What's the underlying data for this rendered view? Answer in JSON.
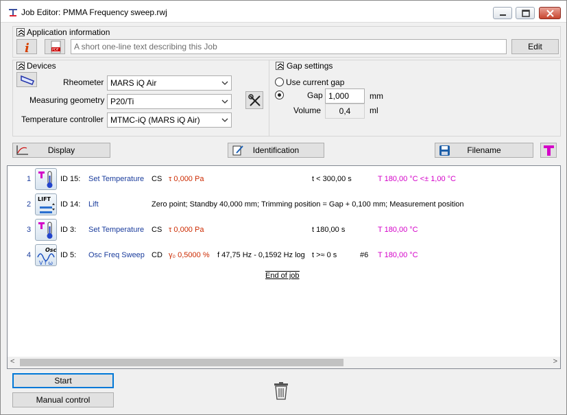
{
  "window": {
    "title": "Job Editor: PMMA Frequency sweep.rwj"
  },
  "application_info": {
    "header": "Application information",
    "description_placeholder": "A short one-line text describing this Job",
    "edit_label": "Edit"
  },
  "devices": {
    "header": "Devices",
    "rheometer_label": "Rheometer",
    "rheometer_value": "MARS iQ Air",
    "geometry_label": "Measuring geometry",
    "geometry_value": "P20/Ti",
    "temp_label": "Temperature controller",
    "temp_value": "MTMC-iQ (MARS iQ Air)"
  },
  "gap": {
    "header": "Gap settings",
    "use_current_label": "Use current gap",
    "gap_label": "Gap",
    "gap_value": "1,000",
    "gap_unit": "mm",
    "volume_label": "Volume",
    "volume_value": "0,4",
    "volume_unit": "ml",
    "selected": "gap"
  },
  "toolbar": {
    "display_label": "Display",
    "identification_label": "Identification",
    "filename_label": "Filename"
  },
  "job_steps": [
    {
      "num": "1",
      "id": "ID 15:",
      "name": "Set Temperature",
      "mode": "CS",
      "param": "τ 0,000 Pa",
      "time": "t < 300,00 s",
      "temp": "T 180,00 °C <± 1,00 °C",
      "icon": "thermometer-icon"
    },
    {
      "num": "2",
      "id": "ID 14:",
      "name": "Lift",
      "detail": "Zero point; Standby 40,000 mm; Trimming position = Gap  + 0,100 mm; Measurement position",
      "icon": "lift-icon"
    },
    {
      "num": "3",
      "id": "ID 3:",
      "name": "Set Temperature",
      "mode": "CS",
      "param": "τ 0,000 Pa",
      "time": "t 180,00 s",
      "temp": "T 180,00 °C",
      "icon": "thermometer-icon"
    },
    {
      "num": "4",
      "id": "ID 5:",
      "name": "Osc Freq Sweep",
      "mode": "CD",
      "param": "γ₀ 0,5000 %",
      "freq": "f 47,75 Hz - 0,1592 Hz log",
      "time": "t >≈ 0 s",
      "count": "#6",
      "temp": "T 180,00 °C",
      "icon": "osc-sweep-icon"
    }
  ],
  "end_of_job": "End of job",
  "bottom": {
    "start_label": "Start",
    "manual_label": "Manual control"
  },
  "colors": {
    "step_name": "#1a3c9c",
    "param": "#cc2a00",
    "temperature": "#d400c8"
  }
}
